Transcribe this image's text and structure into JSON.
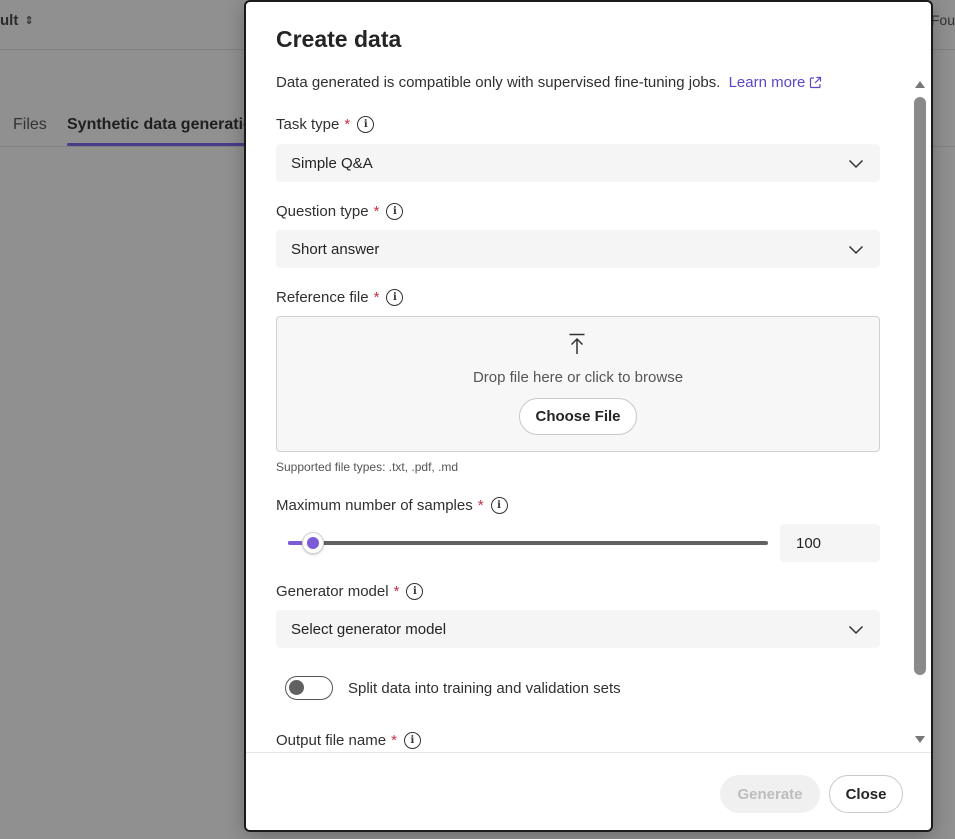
{
  "background": {
    "project_label": "ult",
    "project_switch_icon": "chevron-up-down-icon",
    "right_edge_text": "Fou",
    "tabs": [
      {
        "label": "Files"
      },
      {
        "label": "Synthetic data generatic"
      }
    ]
  },
  "modal": {
    "title": "Create data",
    "description": "Data generated is compatible only with supervised fine-tuning jobs.",
    "learn_more": "Learn more",
    "required_marker": "*",
    "task_type": {
      "label": "Task type",
      "value": "Simple Q&A"
    },
    "question_type": {
      "label": "Question type",
      "value": "Short answer"
    },
    "reference_file": {
      "label": "Reference file",
      "drop_text": "Drop file here or click to browse",
      "button": "Choose File",
      "help": "Supported file types: .txt, .pdf, .md"
    },
    "max_samples": {
      "label": "Maximum number of samples",
      "value": "100"
    },
    "generator_model": {
      "label": "Generator model",
      "placeholder": "Select generator model"
    },
    "split_toggle": {
      "label": "Split data into training and validation sets",
      "on": false
    },
    "output_file": {
      "label": "Output file name"
    },
    "footer": {
      "generate": "Generate",
      "close": "Close"
    }
  },
  "colors": {
    "accent": "#7b5cd6",
    "link": "#5b47c9",
    "required": "#c4314b"
  }
}
